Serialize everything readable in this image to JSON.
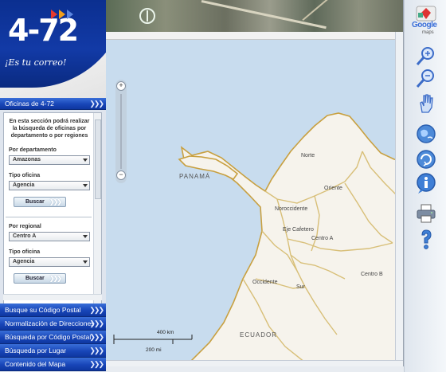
{
  "logo": {
    "number": "4-72",
    "slogan": "¡Es tu correo!",
    "chevron_colors": [
      "#e63b2e",
      "#f2a01b",
      "#2a59c9"
    ]
  },
  "panel": {
    "header": "Oficinas de 4-72",
    "intro": "En esta sección podrá realizar la búsqueda de oficinas por departamento o por regiones",
    "dept_label": "Por departamento",
    "dept_value": "Amazonas",
    "tipo_label_1": "Tipo oficina",
    "tipo_value_1": "Agencia",
    "search_button_1": "Buscar",
    "regional_label": "Por regional",
    "regional_value": "Centro A",
    "tipo_label_2": "Tipo oficina",
    "tipo_value_2": "Agencia",
    "search_button_2": "Buscar"
  },
  "menu": [
    {
      "label": "Busque su Código Postal"
    },
    {
      "label": "Normalización de Direcciones"
    },
    {
      "label": "Búsqueda por Código Postal"
    },
    {
      "label": "Búsqueda por Lugar"
    },
    {
      "label": "Contenido del Mapa"
    }
  ],
  "map": {
    "country_labels": [
      "PANAMÁ",
      "ECUADOR"
    ],
    "region_labels": [
      "Norte",
      "Oriente",
      "Noroccidente",
      "Eje Cafetero",
      "Centro A",
      "Occidente",
      "Sur",
      "Centro B"
    ],
    "zoom_in": "+",
    "zoom_out": "−",
    "scale_km": "400 km",
    "scale_mi": "200 mi",
    "water_color": "#c8dcee",
    "land_color": "#f6f3ec",
    "border_color": "#c8a040"
  },
  "toolbar": {
    "brand": "Google",
    "brand_sub": "maps",
    "tools": [
      "zoom-in-icon",
      "zoom-out-icon",
      "pan-hand-icon",
      "globe-icon",
      "refresh-globe-icon",
      "info-icon",
      "print-icon",
      "help-icon"
    ]
  }
}
